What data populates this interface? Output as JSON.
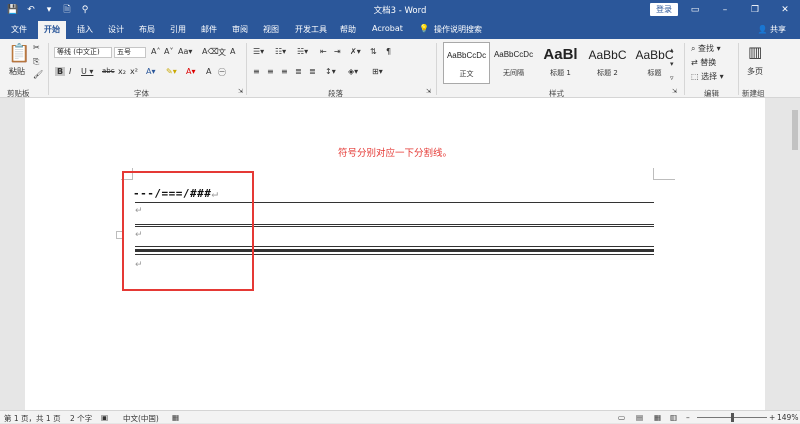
{
  "titlebar": {
    "title": "文档3 - Word",
    "login_label": "登录",
    "icons": [
      "save-icon",
      "undo-icon",
      "redo-icon",
      "new-doc-icon",
      "customize-icon"
    ]
  },
  "menu": {
    "tabs": [
      "文件",
      "开始",
      "插入",
      "设计",
      "布局",
      "引用",
      "邮件",
      "审阅",
      "视图",
      "开发工具",
      "帮助",
      "Acrobat"
    ],
    "active_tab": "开始",
    "search_label": "操作说明搜索",
    "share_label": "共享"
  },
  "ribbon": {
    "clipboard": {
      "paste_label": "粘贴",
      "group_label": "剪贴板"
    },
    "font": {
      "font_name": "等线 (中文正)",
      "font_size": "五号",
      "group_label": "字体"
    },
    "paragraph": {
      "group_label": "段落"
    },
    "styles": {
      "group_label": "样式",
      "items": [
        {
          "sample": "AaBbCcDc",
          "name": "正文"
        },
        {
          "sample": "AaBbCcDc",
          "name": "无间隔"
        },
        {
          "sample": "AaBl",
          "name": "标题 1"
        },
        {
          "sample": "AaBbC",
          "name": "标题 2"
        },
        {
          "sample": "AaBbC",
          "name": "标题"
        }
      ]
    },
    "editing": {
      "find_label": "查找",
      "replace_label": "替换",
      "select_label": "选择",
      "group_label": "编辑"
    },
    "newgroup": {
      "multipage_label": "多页",
      "group_label": "新建组"
    }
  },
  "document": {
    "note": "符号分别对应一下分割线。",
    "line1_text": "---/===/###",
    "para_mark": "↵"
  },
  "statusbar": {
    "page": "第 1 页，共 1 页",
    "words": "2 个字",
    "language": "中文(中国)",
    "zoom": "149%"
  },
  "colors": {
    "accent": "#2b579a",
    "note": "#e53935",
    "highlight_box": "#e53935"
  }
}
